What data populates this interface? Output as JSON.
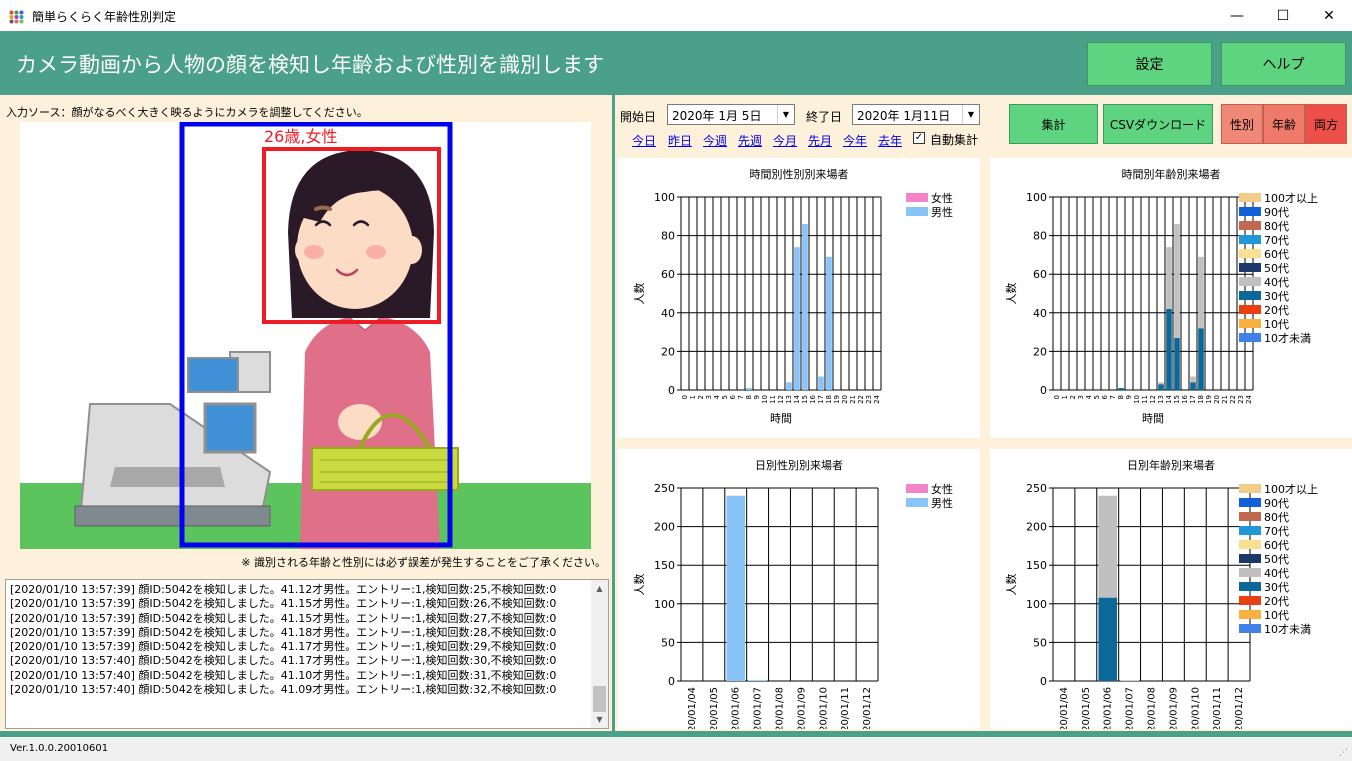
{
  "window": {
    "title": "簡単らくらく年齢性別判定",
    "minimize": "—",
    "maximize": "☐",
    "close": "✕"
  },
  "header": {
    "title": "カメラ動画から人物の顔を検知し年齢および性別を識別します",
    "settings_label": "設定",
    "help_label": "ヘルプ"
  },
  "camera": {
    "source_label": "入力ソース：顔がなるべく大きく映るようにカメラを調整してください。",
    "face_label": "26歳,女性",
    "disclaimer": "※ 識別される年齢と性別には必ず誤差が発生することをご了承ください。"
  },
  "log": {
    "lines": [
      "[2020/01/10 13:57:39] 顔ID:5042を検知しました。41.12才男性。エントリー:1,検知回数:25,不検知回数:0",
      "[2020/01/10 13:57:39] 顔ID:5042を検知しました。41.15才男性。エントリー:1,検知回数:26,不検知回数:0",
      "[2020/01/10 13:57:39] 顔ID:5042を検知しました。41.15才男性。エントリー:1,検知回数:27,不検知回数:0",
      "[2020/01/10 13:57:39] 顔ID:5042を検知しました。41.18才男性。エントリー:1,検知回数:28,不検知回数:0",
      "[2020/01/10 13:57:39] 顔ID:5042を検知しました。41.17才男性。エントリー:1,検知回数:29,不検知回数:0",
      "[2020/01/10 13:57:40] 顔ID:5042を検知しました。41.17才男性。エントリー:1,検知回数:30,不検知回数:0",
      "[2020/01/10 13:57:40] 顔ID:5042を検知しました。41.10才男性。エントリー:1,検知回数:31,不検知回数:0",
      "[2020/01/10 13:57:40] 顔ID:5042を検知しました。41.09才男性。エントリー:1,検知回数:32,不検知回数:0"
    ],
    "text": ""
  },
  "controls": {
    "start_label": "開始日",
    "start_value": "2020年  1月  5日",
    "end_label": "終了日",
    "end_value": "2020年  1月11日",
    "quick_links": [
      "今日",
      "昨日",
      "今週",
      "先週",
      "今月",
      "先月",
      "今年",
      "去年"
    ],
    "auto_label": "自動集計",
    "auto_checked": "✓",
    "aggregate_label": "集計",
    "csv_label": "CSVダウンロード",
    "gender_label": "性別",
    "age_label": "年齢",
    "both_label": "両方"
  },
  "legends": {
    "gender": [
      {
        "name": "女性",
        "color": "#f484c8"
      },
      {
        "name": "男性",
        "color": "#88c4f8"
      }
    ],
    "age": [
      {
        "name": "100才以上",
        "color": "#f2cc88"
      },
      {
        "name": "90代",
        "color": "#1060d8"
      },
      {
        "name": "80代",
        "color": "#c06850"
      },
      {
        "name": "70代",
        "color": "#2098d8"
      },
      {
        "name": "60代",
        "color": "#f8e090"
      },
      {
        "name": "50代",
        "color": "#1c3868"
      },
      {
        "name": "40代",
        "color": "#c0c0c0"
      },
      {
        "name": "30代",
        "color": "#0c6898"
      },
      {
        "name": "20代",
        "color": "#e84010"
      },
      {
        "name": "10代",
        "color": "#f8b040"
      },
      {
        "name": "10才未満",
        "color": "#4080e8"
      }
    ]
  },
  "chart_data": [
    {
      "type": "bar",
      "title": "時間別性別別来場者",
      "xlabel": "時間",
      "ylabel": "人数",
      "categories": [
        "0",
        "1",
        "2",
        "3",
        "4",
        "5",
        "6",
        "7",
        "8",
        "9",
        "10",
        "11",
        "12",
        "13",
        "14",
        "15",
        "16",
        "17",
        "18",
        "19",
        "20",
        "21",
        "22",
        "23",
        "24"
      ],
      "ylim": [
        0,
        100
      ],
      "yticks": [
        0,
        20,
        40,
        60,
        80,
        100
      ],
      "grid": true,
      "legend": "top-right",
      "series": [
        {
          "name": "女性",
          "values": [
            0,
            0,
            0,
            0,
            0,
            0,
            0,
            0,
            0,
            0,
            0,
            0,
            0,
            0,
            0,
            0,
            0,
            0,
            0,
            0,
            0,
            0,
            0,
            0,
            0
          ]
        },
        {
          "name": "男性",
          "values": [
            0,
            0,
            0,
            0,
            0,
            0,
            0,
            0,
            1,
            0,
            0,
            0,
            0,
            4,
            74,
            86,
            0,
            7,
            69,
            0,
            0,
            0,
            0,
            0,
            0
          ]
        }
      ]
    },
    {
      "type": "bar",
      "title": "時間別年齢別来場者",
      "xlabel": "時間",
      "ylabel": "人数",
      "categories": [
        "0",
        "1",
        "2",
        "3",
        "4",
        "5",
        "6",
        "7",
        "8",
        "9",
        "10",
        "11",
        "12",
        "13",
        "14",
        "15",
        "16",
        "17",
        "18",
        "19",
        "20",
        "21",
        "22",
        "23",
        "24"
      ],
      "ylim": [
        0,
        100
      ],
      "yticks": [
        0,
        20,
        40,
        60,
        80,
        100
      ],
      "grid": true,
      "legend": "top-right",
      "stacked": true,
      "series": [
        {
          "name": "30代",
          "values": [
            0,
            0,
            0,
            0,
            0,
            0,
            0,
            0,
            1,
            0,
            0,
            0,
            0,
            3,
            42,
            27,
            0,
            4,
            32,
            0,
            0,
            0,
            0,
            0,
            0
          ]
        },
        {
          "name": "40代",
          "values": [
            0,
            0,
            0,
            0,
            0,
            0,
            0,
            0,
            0,
            0,
            0,
            0,
            0,
            1,
            32,
            59,
            0,
            3,
            37,
            0,
            0,
            0,
            0,
            0,
            0
          ]
        }
      ]
    },
    {
      "type": "bar",
      "title": "日別性別別来場者",
      "xlabel": "日",
      "ylabel": "人数",
      "categories": [
        "2020/01/04",
        "2020/01/05",
        "2020/01/06",
        "2020/01/07",
        "2020/01/08",
        "2020/01/09",
        "2020/01/10",
        "2020/01/11",
        "2020/01/12"
      ],
      "ylim": [
        0,
        250
      ],
      "yticks": [
        0,
        50,
        100,
        150,
        200,
        250
      ],
      "grid": true,
      "legend": "top-right",
      "series": [
        {
          "name": "女性",
          "values": [
            0,
            0,
            0,
            0,
            0,
            0,
            0,
            0,
            0
          ]
        },
        {
          "name": "男性",
          "values": [
            0,
            0,
            240,
            1,
            0,
            0,
            0,
            0,
            0
          ]
        }
      ]
    },
    {
      "type": "bar",
      "title": "日別年齢別来場者",
      "xlabel": "日",
      "ylabel": "人数",
      "categories": [
        "2020/01/04",
        "2020/01/05",
        "2020/01/06",
        "2020/01/07",
        "2020/01/08",
        "2020/01/09",
        "2020/01/10",
        "2020/01/11",
        "2020/01/12"
      ],
      "ylim": [
        0,
        250
      ],
      "yticks": [
        0,
        50,
        100,
        150,
        200,
        250
      ],
      "grid": true,
      "legend": "top-right",
      "stacked": true,
      "series": [
        {
          "name": "30代",
          "values": [
            0,
            0,
            108,
            0,
            0,
            0,
            0,
            0,
            0
          ]
        },
        {
          "name": "40代",
          "values": [
            0,
            0,
            132,
            1,
            0,
            0,
            0,
            0,
            0
          ]
        }
      ]
    }
  ],
  "status": {
    "version": "Ver.1.0.0.20010601",
    "grip": "⋰"
  }
}
